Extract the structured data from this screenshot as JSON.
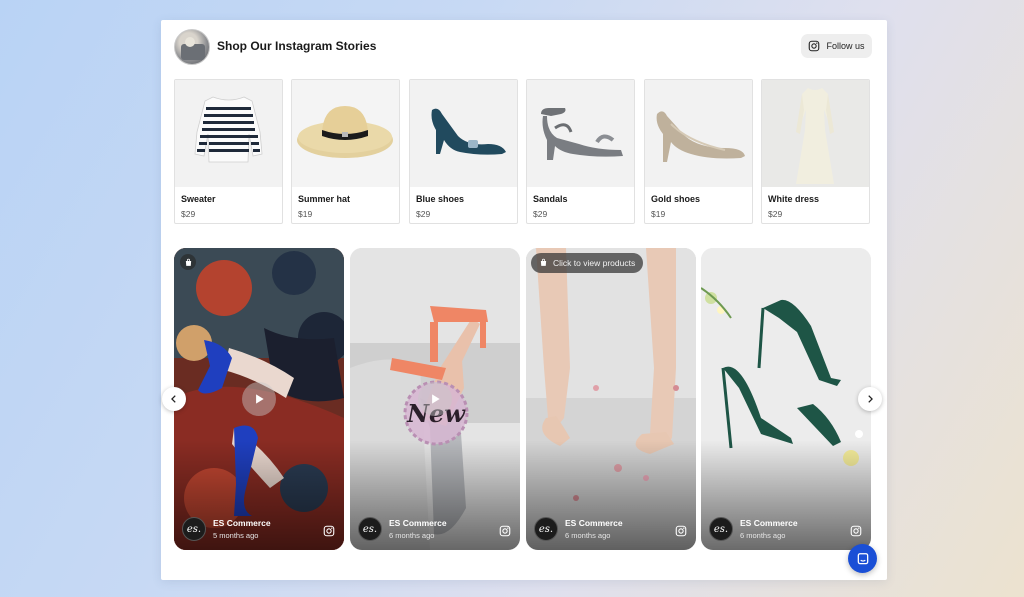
{
  "header": {
    "title": "Shop Our Instagram Stories",
    "follow_label": "Follow us"
  },
  "products": [
    {
      "name": "Sweater",
      "price": "$29",
      "icon": "striped-sweater"
    },
    {
      "name": "Summer hat",
      "price": "$19",
      "icon": "straw-hat"
    },
    {
      "name": "Blue shoes",
      "price": "$29",
      "icon": "blue-pump"
    },
    {
      "name": "Sandals",
      "price": "$29",
      "icon": "gray-sandal"
    },
    {
      "name": "Gold shoes",
      "price": "$19",
      "icon": "gold-pump"
    },
    {
      "name": "White dress",
      "price": "$29",
      "icon": "white-dress"
    }
  ],
  "stories": [
    {
      "account": "ES Commerce",
      "time": "5 months ago"
    },
    {
      "account": "ES Commerce",
      "time": "6 months ago",
      "overlay_text": "New"
    },
    {
      "account": "ES Commerce",
      "time": "6 months ago",
      "cta": "Click to view products"
    },
    {
      "account": "ES Commerce",
      "time": "6 months ago"
    }
  ],
  "logo_text": "es.",
  "colors": {
    "accent_chat": "#1a4fd6",
    "card_border": "#e1e1e1"
  }
}
